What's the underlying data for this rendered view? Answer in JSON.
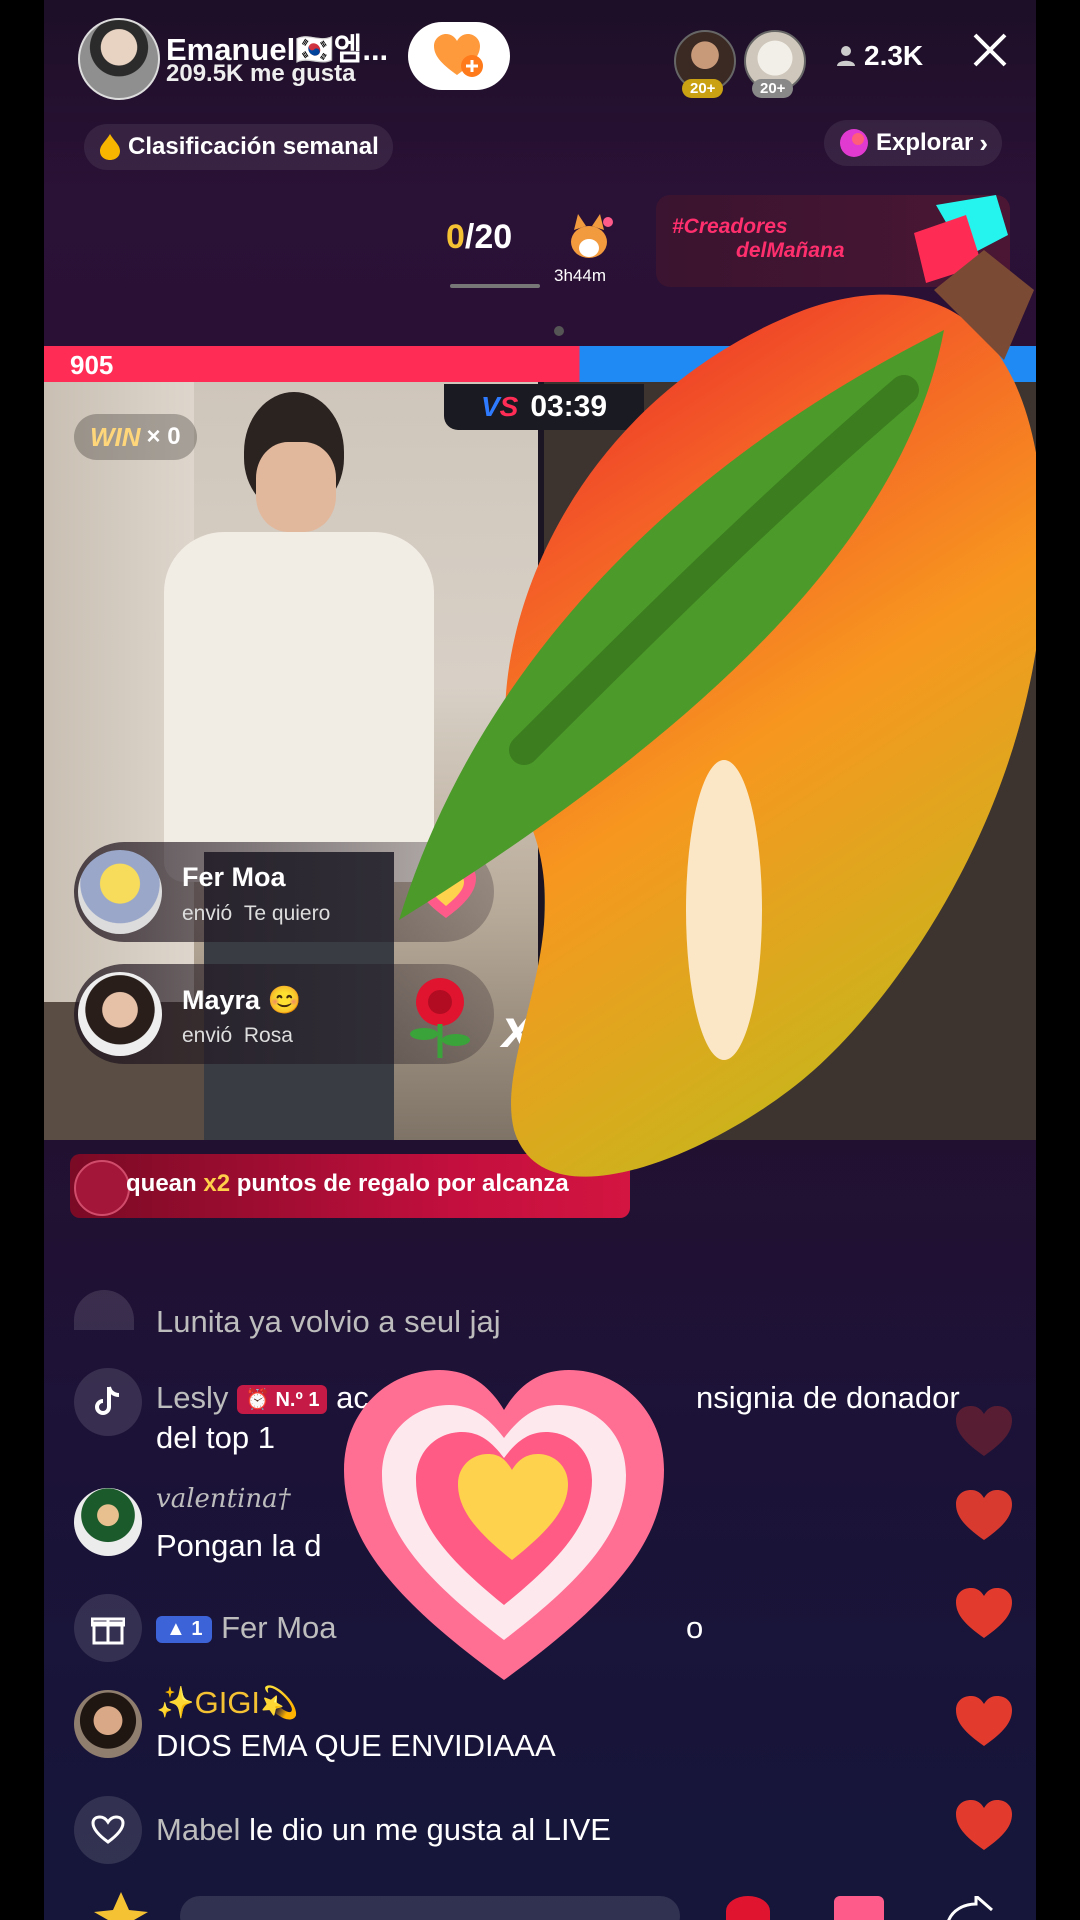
{
  "header": {
    "host_name": "Emanuel🇰🇷엠...",
    "host_likes": "209.5K me gusta",
    "viewer_badges": [
      "20+",
      "20+"
    ],
    "viewer_count": "2.3K"
  },
  "ranking": {
    "label": "Clasificación semanal"
  },
  "explore": {
    "label": "Explorar"
  },
  "goal": {
    "current": "0",
    "total": "/20",
    "time_left": "3h44m"
  },
  "campaign": {
    "hashtag": "#Creadores",
    "subtitle": "delMañana"
  },
  "battle": {
    "score_left": "905",
    "timer": "03:39",
    "win_label": "WIN",
    "win_count": "× 0"
  },
  "gifts": [
    {
      "user": "Fer Moa",
      "action": "envió",
      "gift": "Te quiero"
    },
    {
      "user": "Mayra 😊",
      "action": "envió",
      "gift": "Rosa",
      "multiplier": "x1"
    }
  ],
  "banner": {
    "pre": "quean ",
    "highlight": "x2",
    "post": " puntos de regalo por alcanza"
  },
  "chat": [
    {
      "user": "Lunita ya volvio a seul jaj",
      "text": ""
    },
    {
      "user": "Lesly",
      "badge": "N.º 1",
      "text": "ac",
      "text2": "nsignia de donador",
      "text3": "del top 1"
    },
    {
      "user": "valentina†",
      "text": "Pongan la d"
    },
    {
      "user": "Fer Moa",
      "level": "1",
      "text": "o"
    },
    {
      "user": "✨GIGI💫",
      "text": "DIOS EMA QUE ENVIDIAAA"
    },
    {
      "user": "Mabel",
      "text": "le dio un me gusta al LIVE"
    }
  ],
  "colors": {
    "accent_red": "#ff2c55",
    "accent_blue": "#1f8af3",
    "goal_yellow": "#f5c234"
  }
}
